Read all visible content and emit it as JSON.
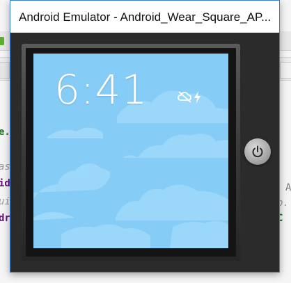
{
  "emulator": {
    "title": "Android Emulator - Android_Wear_Square_AP..."
  },
  "watch": {
    "time": "6:41",
    "status_icons": [
      "cloud-off-icon",
      "bolt-icon"
    ],
    "screen_color": "#85cdf7"
  },
  "power_button": {
    "icon": "power-icon"
  },
  "background_ide": {
    "fragments": {
      "left_green": "e.",
      "left_grey1": "as",
      "left_purple1": "id",
      "left_grey2": "ui",
      "left_purple2": "dr",
      "right_grey1": "A",
      "right_grey2": "p.",
      "right_green": "C"
    }
  }
}
